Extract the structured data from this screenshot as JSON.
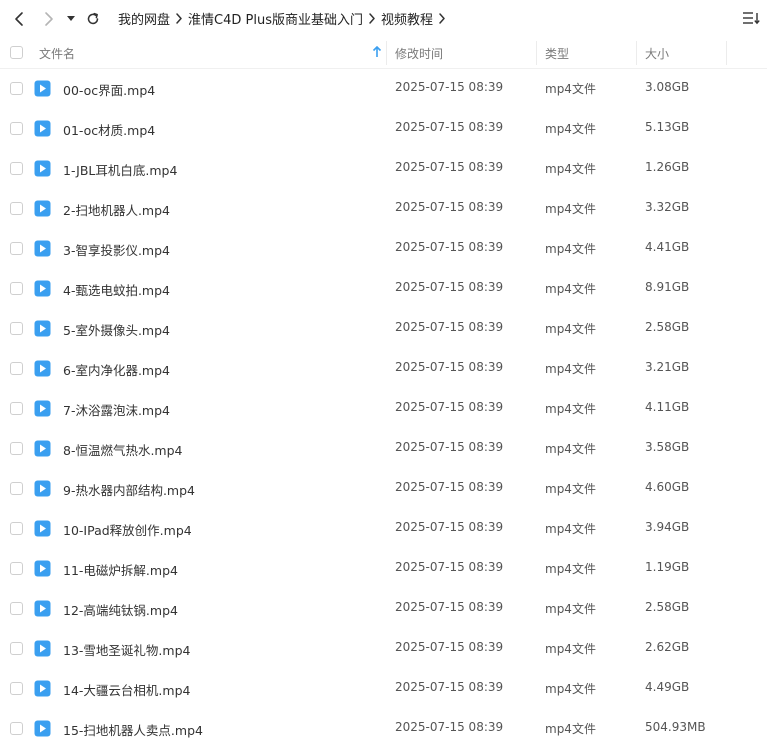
{
  "breadcrumb": [
    "我的网盘",
    "淮情C4D Plus版商业基础入门",
    "视频教程"
  ],
  "columns": {
    "name": "文件名",
    "mtime": "修改时间",
    "type": "类型",
    "size": "大小"
  },
  "colors": {
    "accent": "#3a9ff0",
    "icon_blue": "#3a9ff0"
  },
  "files": [
    {
      "name": "00-oc界面.mp4",
      "mtime": "2025-07-15 08:39",
      "type": "mp4文件",
      "size": "3.08GB"
    },
    {
      "name": "01-oc材质.mp4",
      "mtime": "2025-07-15 08:39",
      "type": "mp4文件",
      "size": "5.13GB"
    },
    {
      "name": "1-JBL耳机白底.mp4",
      "mtime": "2025-07-15 08:39",
      "type": "mp4文件",
      "size": "1.26GB"
    },
    {
      "name": "2-扫地机器人.mp4",
      "mtime": "2025-07-15 08:39",
      "type": "mp4文件",
      "size": "3.32GB"
    },
    {
      "name": "3-智享投影仪.mp4",
      "mtime": "2025-07-15 08:39",
      "type": "mp4文件",
      "size": "4.41GB"
    },
    {
      "name": "4-甄选电蚊拍.mp4",
      "mtime": "2025-07-15 08:39",
      "type": "mp4文件",
      "size": "8.91GB"
    },
    {
      "name": "5-室外摄像头.mp4",
      "mtime": "2025-07-15 08:39",
      "type": "mp4文件",
      "size": "2.58GB"
    },
    {
      "name": "6-室内净化器.mp4",
      "mtime": "2025-07-15 08:39",
      "type": "mp4文件",
      "size": "3.21GB"
    },
    {
      "name": "7-沐浴露泡沫.mp4",
      "mtime": "2025-07-15 08:39",
      "type": "mp4文件",
      "size": "4.11GB"
    },
    {
      "name": "8-恒温燃气热水.mp4",
      "mtime": "2025-07-15 08:39",
      "type": "mp4文件",
      "size": "3.58GB"
    },
    {
      "name": "9-热水器内部结构.mp4",
      "mtime": "2025-07-15 08:39",
      "type": "mp4文件",
      "size": "4.60GB"
    },
    {
      "name": "10-IPad释放创作.mp4",
      "mtime": "2025-07-15 08:39",
      "type": "mp4文件",
      "size": "3.94GB"
    },
    {
      "name": "11-电磁炉拆解.mp4",
      "mtime": "2025-07-15 08:39",
      "type": "mp4文件",
      "size": "1.19GB"
    },
    {
      "name": "12-高端纯钛锅.mp4",
      "mtime": "2025-07-15 08:39",
      "type": "mp4文件",
      "size": "2.58GB"
    },
    {
      "name": "13-雪地圣诞礼物.mp4",
      "mtime": "2025-07-15 08:39",
      "type": "mp4文件",
      "size": "2.62GB"
    },
    {
      "name": "14-大疆云台相机.mp4",
      "mtime": "2025-07-15 08:39",
      "type": "mp4文件",
      "size": "4.49GB"
    },
    {
      "name": "15-扫地机器人卖点.mp4",
      "mtime": "2025-07-15 08:39",
      "type": "mp4文件",
      "size": "504.93MB"
    }
  ]
}
